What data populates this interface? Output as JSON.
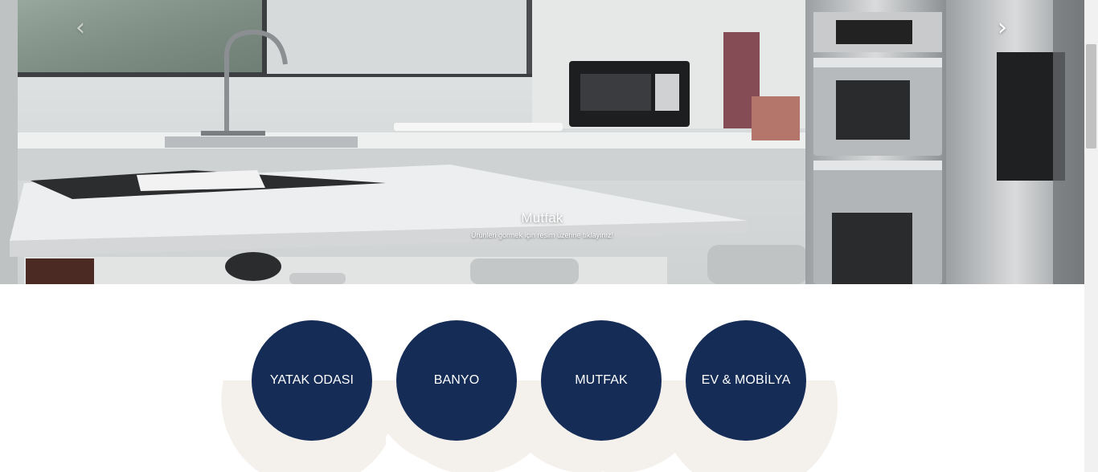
{
  "hero": {
    "title": "Mutfak",
    "subtitle": "Ürünleri görmek için resim üzerine tıklayınız!",
    "prev_icon": "chevron-left-icon",
    "next_icon": "chevron-right-icon"
  },
  "categories": {
    "items": [
      {
        "label": "YATAK ODASI"
      },
      {
        "label": "BANYO"
      },
      {
        "label": "MUTFAK"
      },
      {
        "label": "EV & MOBİLYA"
      }
    ]
  },
  "colors": {
    "circle": "#152c57",
    "arc_band": "#f4f0ec"
  }
}
